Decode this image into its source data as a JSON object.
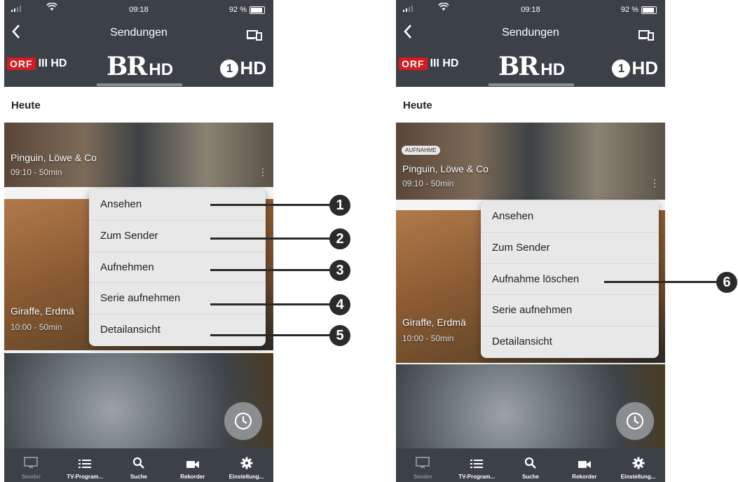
{
  "status_bar": {
    "time": "09:18",
    "battery": "92 %"
  },
  "nav": {
    "title": "Sendungen"
  },
  "channels": {
    "orf": "ORF",
    "orf_suffix": "III HD",
    "br": "BR",
    "br_suffix": "HD",
    "one": "1",
    "one_suffix": "HD"
  },
  "day_label": "Heute",
  "shows": [
    {
      "title": "Pinguin, Löwe & Co",
      "time": "09:10 - 50min"
    },
    {
      "title": "Giraffe, Erdmä",
      "time": "10:00 - 50min"
    }
  ],
  "right_badge": "AUFNAHME",
  "menu_left": [
    "Ansehen",
    "Zum Sender",
    "Aufnehmen",
    "Serie aufnehmen",
    "Detailansicht"
  ],
  "menu_right": [
    "Ansehen",
    "Zum Sender",
    "Aufnahme löschen",
    "Serie aufnehmen",
    "Detailansicht"
  ],
  "callouts": [
    "1",
    "2",
    "3",
    "4",
    "5",
    "6"
  ],
  "tabs": [
    {
      "label": "Sender",
      "icon": "tv-icon"
    },
    {
      "label": "TV-Program...",
      "icon": "list-icon"
    },
    {
      "label": "Suche",
      "icon": "search-icon"
    },
    {
      "label": "Rekorder",
      "icon": "camera-icon"
    },
    {
      "label": "Einstellung...",
      "icon": "gear-icon"
    }
  ]
}
